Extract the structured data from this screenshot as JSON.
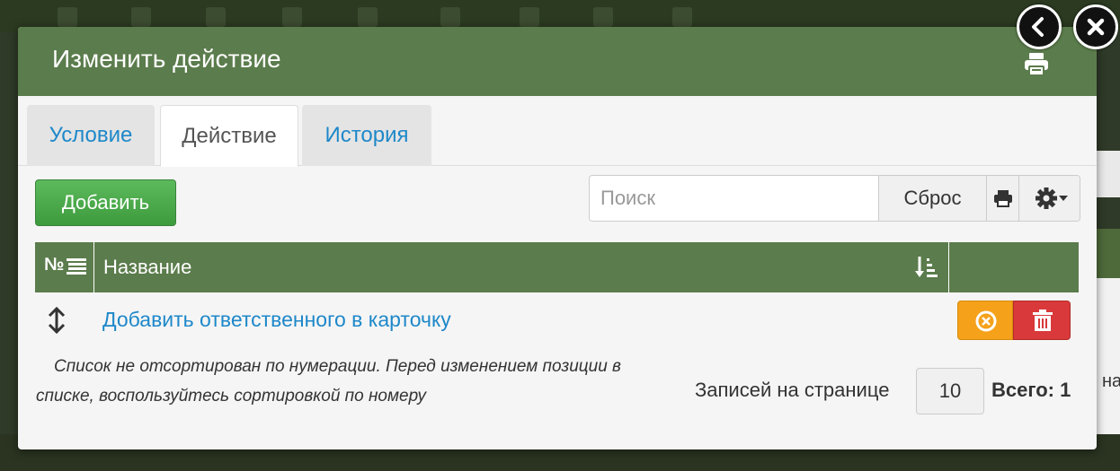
{
  "modal": {
    "title": "Изменить действие"
  },
  "tabs": [
    {
      "label": "Условие",
      "active": false
    },
    {
      "label": "Действие",
      "active": true
    },
    {
      "label": "История",
      "active": false
    }
  ],
  "toolbar": {
    "add_label": "Добавить",
    "search_placeholder": "Поиск",
    "search_value": "",
    "reset_label": "Сброс"
  },
  "table": {
    "col_num": "№",
    "col_name": "Название",
    "rows": [
      {
        "name": "Добавить ответственного в карточку"
      }
    ]
  },
  "footer": {
    "note": "Список не отсортирован по нумерации. Перед изменением позиции в списке, воспользуйтесь сортировкой по номеру",
    "page_size_label": "Записей на странице",
    "page_size": "10",
    "total": "Всего: 1"
  },
  "background": {
    "partial_text": "на"
  },
  "colors": {
    "header_green": "#5b7c4c",
    "link_blue": "#1e88c9",
    "add_green": "#4cae4c",
    "cancel_orange": "#f5a11a",
    "delete_red": "#d9393a"
  },
  "icons": {
    "back": "chevron-left-icon",
    "close": "close-icon",
    "print": "printer-icon",
    "settings": "gear-icon",
    "sort": "sort-numeric-asc-icon",
    "move": "up-down-arrow-icon",
    "cancel": "cancel-circle-icon",
    "delete": "trash-icon"
  }
}
